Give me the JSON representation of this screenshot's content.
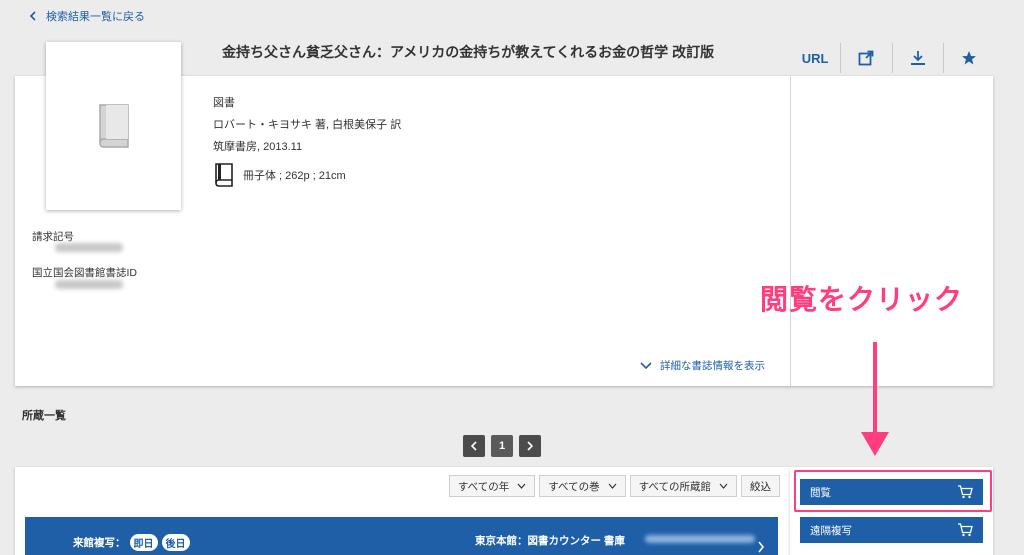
{
  "back_link": "検索結果一覧に戻る",
  "book": {
    "title": "金持ち父さん貧乏父さん：アメリカの金持ちが教えてくれるお金の哲学 改訂版",
    "type": "図書",
    "author": "ロバート・キヨサキ 著, 白根美保子 訳",
    "publisher": "筑摩書房, 2013.11",
    "format": "冊子体 ; 262p ; 21cm"
  },
  "fields": {
    "call_number_label": "請求記号",
    "ndl_id_label": "国立国会図書館書誌ID"
  },
  "actions": {
    "url_label": "URL"
  },
  "detail_link": "詳細な書誌情報を表示",
  "annotation": "閲覧をクリック",
  "holdings": {
    "title": "所蔵一覧",
    "page": "1",
    "filters": [
      "すべての年",
      "すべての巻",
      "すべての所蔵館"
    ],
    "apply_label": "絞込",
    "copy_label": "来館複写：",
    "badge_today": "即日",
    "badge_later": "後日",
    "location": "東京本館：図書カウンター 書庫"
  },
  "side": {
    "view_label": "閲覧",
    "remote_copy_label": "遠隔複写"
  },
  "colors": {
    "accent": "#1e5fa8",
    "annotation": "#ff3d7f"
  }
}
